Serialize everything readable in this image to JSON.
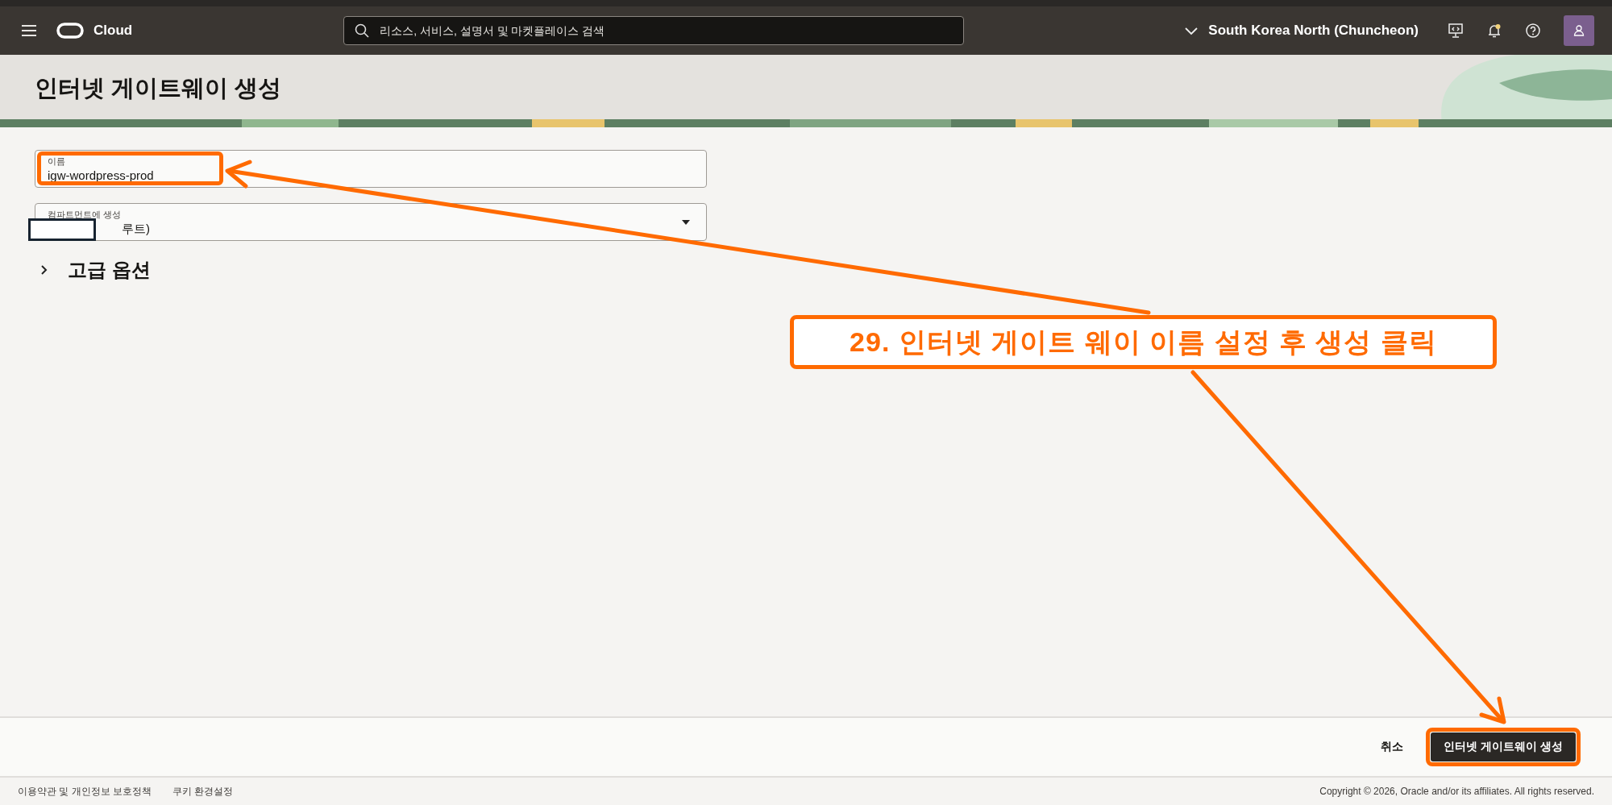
{
  "topbar": {
    "brand": "Cloud",
    "search": {
      "placeholder": "리소스, 서비스, 설명서 및 마켓플레이스 검색"
    },
    "region": "South Korea North (Chuncheon)",
    "notification_dot": true
  },
  "page_title": "인터넷 게이트웨이 생성",
  "form": {
    "fields": [
      {
        "kind": "text",
        "label": "이름",
        "value": "igw-wordpress-prod",
        "highlighted": true
      },
      {
        "kind": "select",
        "label": "컴파트먼트에 생성",
        "value": "루트)",
        "highlighted": false
      }
    ],
    "advanced": {
      "label": "고급 옵션",
      "expanded": false
    }
  },
  "actions": {
    "cancel": "취소",
    "submit": {
      "label": "인터넷 게이트웨이 생성",
      "highlighted": true
    }
  },
  "footer": {
    "links": [
      "이용약관 및 개인정보 보호정책",
      "쿠키 환경설정"
    ],
    "copyright": "Copyright © 2026, Oracle and/or its affiliates. All rights reserved."
  },
  "annotation": {
    "text": "29. 인터넷 게이트 웨이 이름 설정 후 생성 클릭"
  }
}
